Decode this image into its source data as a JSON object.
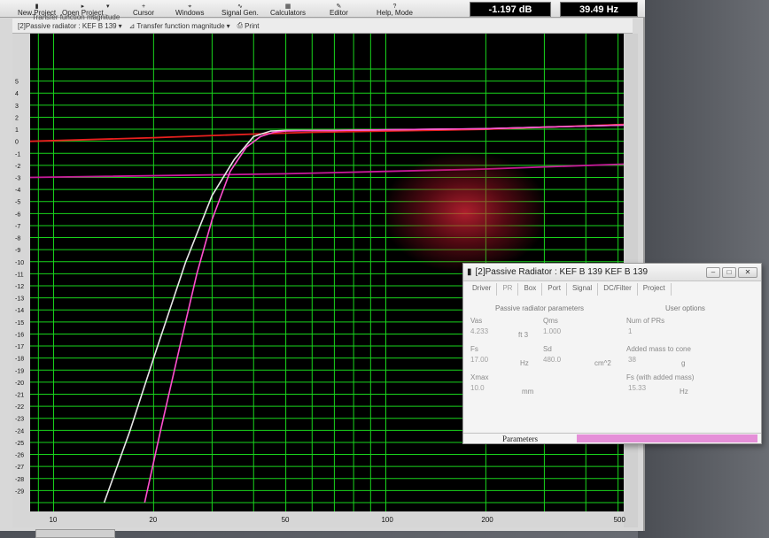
{
  "toolbar": {
    "items": [
      {
        "label": "New Project",
        "icon": "new-project-icon",
        "x": 20
      },
      {
        "label": "Open Project",
        "icon": "open-project-icon",
        "x": 70
      },
      {
        "label": "Cursor",
        "icon": "cursor-icon",
        "x": 150
      },
      {
        "label": "Windows",
        "icon": "windows-icon",
        "x": 198
      },
      {
        "label": "Signal Gen.",
        "icon": "signal-gen-icon",
        "x": 250
      },
      {
        "label": "Calculators",
        "icon": "calculators-icon",
        "x": 305
      },
      {
        "label": "Editor",
        "icon": "editor-icon",
        "x": 372
      },
      {
        "label": "Help, Mode",
        "icon": "help-icon",
        "x": 425
      }
    ],
    "readout_level": "-1.197 dB",
    "readout_freq": "39.49 Hz"
  },
  "subbar": {
    "tiny_title": "Transfer function magnitude",
    "driver_select": "[2]Passive radiator : KEF  B 139",
    "view_select": "Transfer function magnitude",
    "print_label": "Print"
  },
  "chart_data": {
    "type": "line",
    "title": "",
    "xlabel": "",
    "ylabel": "",
    "x_scale": "log",
    "xlim": [
      8.5,
      520
    ],
    "ylim": [
      -30,
      6
    ],
    "x_ticks": [
      10,
      20,
      50,
      100,
      200,
      500
    ],
    "y_ticks": [
      5,
      4,
      3,
      2,
      1,
      0,
      -1,
      -2,
      -3,
      -4,
      -5,
      -6,
      -7,
      -8,
      -9,
      -10,
      -11,
      -12,
      -13,
      -14,
      -15,
      -16,
      -17,
      -18,
      -19,
      -20,
      -21,
      -22,
      -23,
      -24,
      -25,
      -26,
      -27,
      -28,
      -29
    ],
    "grid": true,
    "background": "#000000",
    "grid_color": "#19d41c",
    "series": [
      {
        "color": "#e8201e",
        "x": [
          8.5,
          20,
          40,
          60,
          100,
          200,
          520
        ],
        "y": [
          0.0,
          0.3,
          0.6,
          0.75,
          0.85,
          1.0,
          1.4
        ]
      },
      {
        "color": "#c81a9a",
        "x": [
          8.5,
          50,
          100,
          200,
          520
        ],
        "y": [
          -3.0,
          -2.7,
          -2.5,
          -2.3,
          -1.9
        ]
      },
      {
        "color": "#e6e6e6",
        "x": [
          14.2,
          17,
          20,
          25,
          30,
          35,
          40,
          45,
          50,
          60,
          70,
          100,
          200,
          520
        ],
        "y": [
          -30,
          -24,
          -18,
          -10,
          -4.5,
          -1.5,
          0.4,
          0.85,
          0.9,
          0.9,
          0.9,
          0.95,
          1.05,
          1.35
        ]
      },
      {
        "color": "#ff4fcf",
        "x": [
          18.8,
          21,
          24,
          27,
          30,
          34,
          38,
          42,
          46,
          50,
          60,
          70,
          100,
          200,
          520
        ],
        "y": [
          -30,
          -24,
          -17,
          -11,
          -6.5,
          -2.5,
          -0.5,
          0.4,
          0.75,
          0.85,
          0.9,
          0.9,
          0.95,
          1.05,
          1.35
        ]
      }
    ]
  },
  "dialog": {
    "title": "[2]Passive Radiator : KEF  B 139 KEF  B 139",
    "tabs": [
      "Driver",
      "PR",
      "Box",
      "Port",
      "Signal",
      "DC/Filter",
      "Project"
    ],
    "section_left": "Passive radiator parameters",
    "section_right": "User options",
    "fields": {
      "vas_label": "Vas",
      "vas_value": "4.233",
      "vas_unit": "ft 3",
      "qms_label": "Qms",
      "qms_value": "1.000",
      "fs_label": "Fs",
      "fs_value": "17.00",
      "fs_unit": "Hz",
      "sd_label": "Sd",
      "sd_value": "480.0",
      "sd_unit": "cm^2",
      "xmax_label": "Xmax",
      "xmax_value": "10.0",
      "xmax_unit": "mm",
      "num_prs_label": "Num of PRs",
      "num_prs_value": "1",
      "added_mass_label": "Added mass to cone",
      "added_mass_value": "38",
      "added_mass_unit": "g",
      "fs_added_label": "Fs (with added mass)",
      "fs_added_value": "15.33",
      "fs_added_unit": "Hz"
    },
    "footer_tab": "Parameters",
    "accent": "#e58fd8"
  }
}
